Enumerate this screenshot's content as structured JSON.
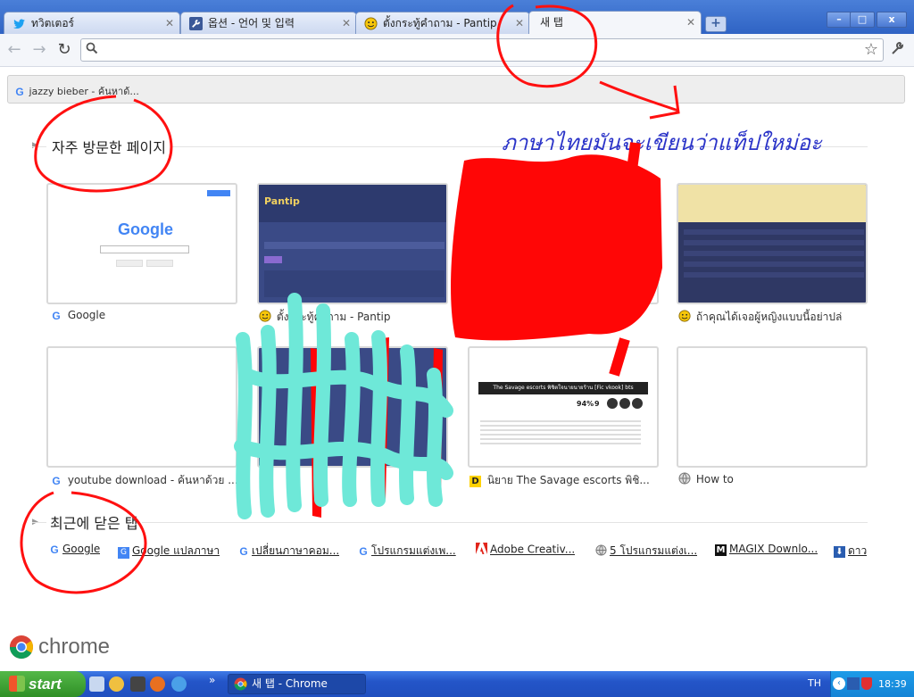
{
  "browser": {
    "tabs": [
      {
        "label": "ทวิตเตอร์",
        "icon": "twitter-bird-icon"
      },
      {
        "label": "옵션 - 언어 및 입력",
        "icon": "wrench-icon"
      },
      {
        "label": "ตั้งกระทู้คำถาม - Pantip",
        "icon": "pantip-smiley-icon"
      },
      {
        "label": "새 탭",
        "icon": "none"
      }
    ],
    "new_tab": "+",
    "window_controls": {
      "minimize": "–",
      "maximize": "□",
      "close": "x"
    }
  },
  "toolbar": {
    "omnibox_value": "",
    "icons": [
      "back-arrow-icon",
      "forward-arrow-icon",
      "reload-icon",
      "search-icon",
      "star-icon",
      "wrench-icon"
    ]
  },
  "bookmarks": {
    "item": "jazzy bieber - ค้นหาด้..."
  },
  "most_visited": {
    "header": "자주 방문한 페이지",
    "annotation": "ภาษาไทยมันจะเขียนว่าแท็ปใหม่อะ",
    "thumbnails": [
      {
        "label": "Google",
        "icon": "google-icon"
      },
      {
        "label": "ตั้งกระทู้คำถาม - Pantip",
        "icon": "pantip-smiley-icon"
      },
      {
        "label": "",
        "icon": "none"
      },
      {
        "label": "ถ้าคุณได้เจอผู้หญิงแบบนี้อย่าปล่",
        "icon": "pantip-smiley-icon"
      },
      {
        "label": "youtube download - ค้นหาด้วย ...",
        "icon": "google-icon"
      },
      {
        "label": "",
        "icon": "none"
      },
      {
        "label": "นิยาย The Savage escorts พิชิ...",
        "icon": "dek-d-icon"
      },
      {
        "label": "How to",
        "icon": "globe-icon"
      }
    ],
    "thumb_texts": {
      "google_logo": "Google",
      "pantip_logo": "Pantip",
      "savage_title": "The Savage escorts พิชิตใจนายนายร้าน [Fic vkook] bts",
      "savage_percent": "94%",
      "savage_count": "9"
    }
  },
  "recently_closed": {
    "header": "최근에 닫은 탭",
    "items": [
      {
        "label": "Google",
        "icon": "google-icon"
      },
      {
        "label": "Google แปลภาษา",
        "icon": "google-translate-icon"
      },
      {
        "label": "เปลี่ยนภาษาคอม...",
        "icon": "google-icon"
      },
      {
        "label": "โปรแกรมแต่งเพ...",
        "icon": "google-icon"
      },
      {
        "label": "Adobe Creativ...",
        "icon": "adobe-icon"
      },
      {
        "label": "5 โปรแกรมแต่งเ...",
        "icon": "globe-icon"
      },
      {
        "label": "MAGIX Downlo...",
        "icon": "magix-icon"
      },
      {
        "label": "ดาว",
        "icon": "download-icon"
      }
    ]
  },
  "branding": {
    "wordmark": "chrome"
  },
  "taskbar": {
    "start": "start",
    "task": "새 탭 - Chrome",
    "lang": "TH",
    "clock": "18:39",
    "chevron": "»"
  },
  "colors": {
    "tabstrip": "#3a6fd0",
    "annotation_blue": "#2a33c8",
    "scribble_red": "#ff0000",
    "scribble_cyan": "#6ee8d8",
    "taskbar": "#2455c8",
    "start_green": "#3a9e30"
  }
}
